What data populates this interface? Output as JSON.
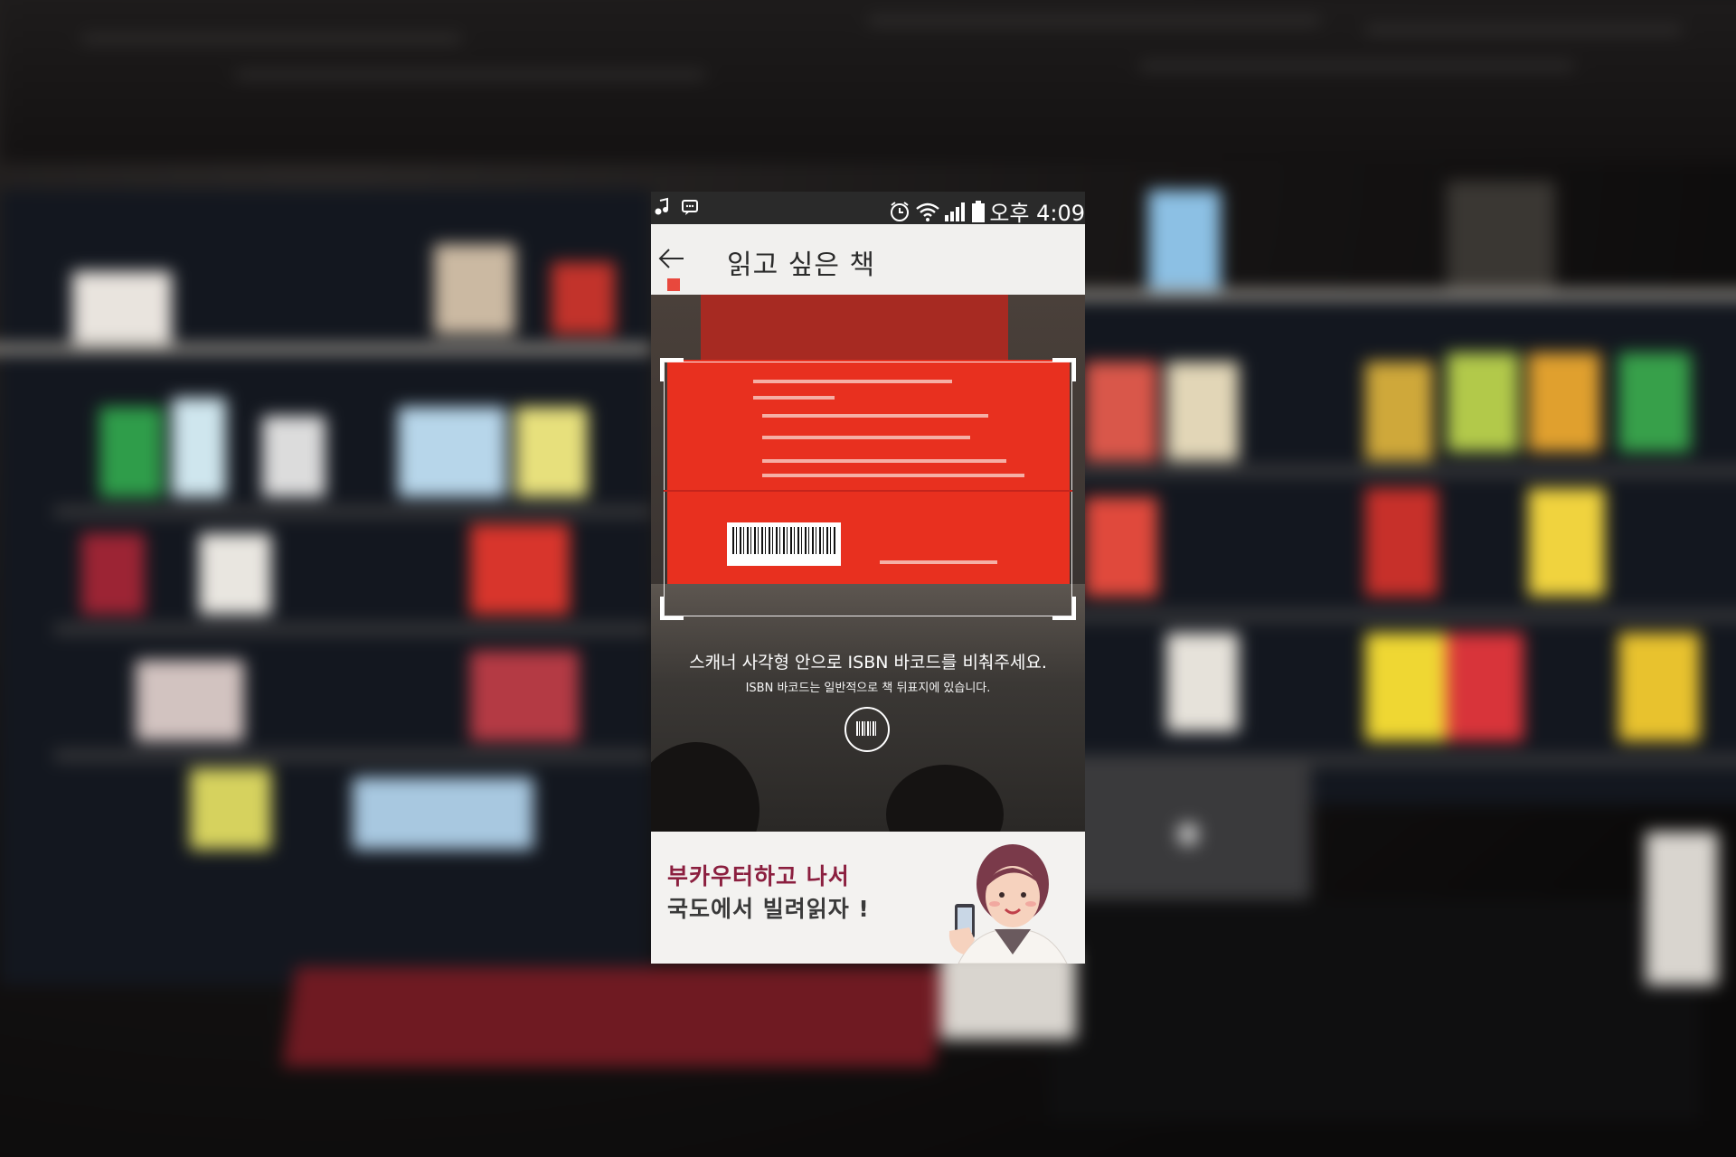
{
  "status_bar": {
    "time": "오후 4:09",
    "left_icons": [
      "music-note-icon",
      "chat-bubble-icon"
    ],
    "right_icons": [
      "alarm-clock-icon",
      "wifi-icon",
      "signal-bars-icon",
      "battery-icon"
    ]
  },
  "app_bar": {
    "title": "읽고 싶은 책",
    "back_icon": "back-arrow-icon"
  },
  "scanner": {
    "instruction": "스캐너 사각형 안으로 ISBN 바코드를 비춰주세요.",
    "hint": "ISBN 바코드는 일반적으로 책 뒤표지에 있습니다.",
    "mode_button_icon": "barcode-icon"
  },
  "banner": {
    "line1": "부카우터하고 나서",
    "line2": "국도에서 빌려읽자 !",
    "illustration_icon": "woman-with-phone-icon"
  },
  "colors": {
    "accent": "#e8483d",
    "banner_text": "#8b1f3f",
    "scan_line": "#c4241c"
  }
}
